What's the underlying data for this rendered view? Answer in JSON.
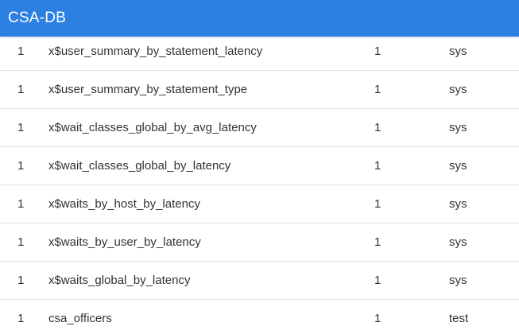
{
  "app": {
    "title": "CSA-DB",
    "accent_color": "#2b80e1"
  },
  "table": {
    "rows": [
      {
        "id": "1",
        "name": "x$user_summary_by_statement_latency",
        "count": "1",
        "schema": "sys"
      },
      {
        "id": "1",
        "name": "x$user_summary_by_statement_type",
        "count": "1",
        "schema": "sys"
      },
      {
        "id": "1",
        "name": "x$wait_classes_global_by_avg_latency",
        "count": "1",
        "schema": "sys"
      },
      {
        "id": "1",
        "name": "x$wait_classes_global_by_latency",
        "count": "1",
        "schema": "sys"
      },
      {
        "id": "1",
        "name": "x$waits_by_host_by_latency",
        "count": "1",
        "schema": "sys"
      },
      {
        "id": "1",
        "name": "x$waits_by_user_by_latency",
        "count": "1",
        "schema": "sys"
      },
      {
        "id": "1",
        "name": "x$waits_global_by_latency",
        "count": "1",
        "schema": "sys"
      },
      {
        "id": "1",
        "name": "csa_officers",
        "count": "1",
        "schema": "test"
      }
    ]
  }
}
